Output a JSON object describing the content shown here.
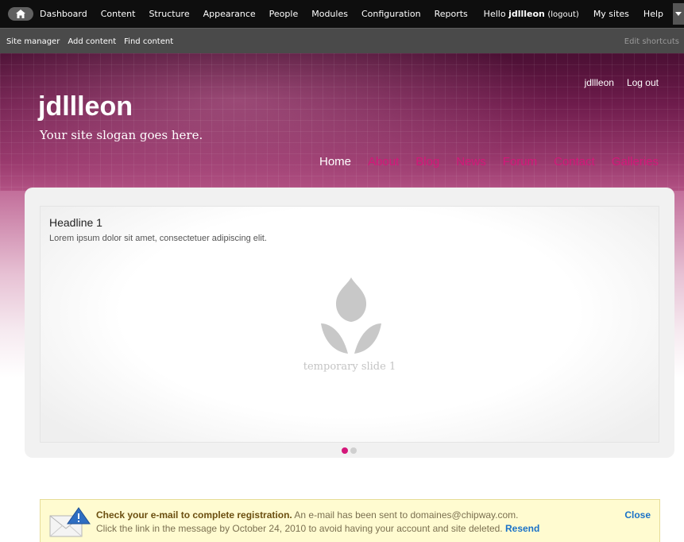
{
  "toolbar": {
    "menu": [
      "Dashboard",
      "Content",
      "Structure",
      "Appearance",
      "People",
      "Modules",
      "Configuration",
      "Reports"
    ],
    "hello_prefix": "Hello",
    "username": "jdllleon",
    "logout_label": "(logout)",
    "my_sites_label": "My sites",
    "help_label": "Help"
  },
  "shortcuts": {
    "items": [
      "Site manager",
      "Add content",
      "Find content"
    ],
    "edit_label": "Edit shortcuts"
  },
  "header": {
    "site_name": "jdllleon",
    "slogan": "Your site slogan goes here.",
    "user_links": [
      "jdllleon",
      "Log out"
    ],
    "nav": [
      "Home",
      "About",
      "Blog",
      "News",
      "Forum",
      "Contact",
      "Galleries"
    ],
    "active_nav": "Home"
  },
  "slideshow": {
    "headline": "Headline 1",
    "text": "Lorem ipsum dolor sit amet, consectetuer adipiscing elit.",
    "caption": "temporary slide 1",
    "total_slides": 2,
    "current_slide": 1
  },
  "message": {
    "title": "Check your e-mail to complete registration.",
    "text": "An e-mail has been sent to domaines@chipway.com.",
    "line2": "Click the link in the message by October 24, 2010 to avoid having your account and site deleted.",
    "resend_label": "Resend",
    "close_label": "Close"
  },
  "colors": {
    "accent": "#d4177a",
    "link": "#1a72c8",
    "toolbar_bg": "#0e0e0e",
    "shortcuts_bg": "#4a4a4a",
    "message_bg": "#fffbd0"
  },
  "icons": [
    "home-icon",
    "chevron-down-icon",
    "tulip-placeholder-icon",
    "envelope-warning-icon"
  ]
}
